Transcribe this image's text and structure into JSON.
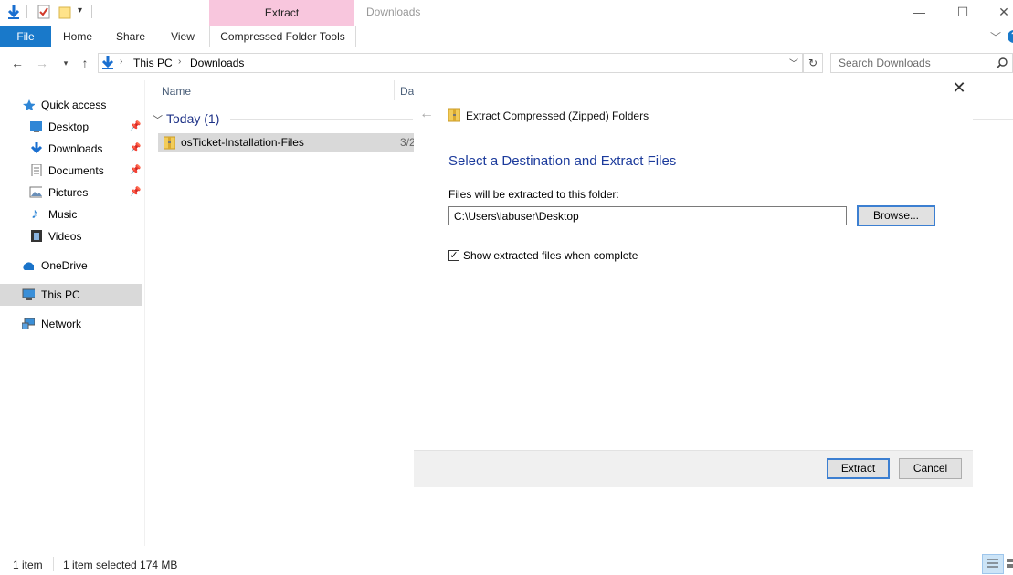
{
  "window": {
    "context_tab_label": "Extract",
    "title": "Downloads",
    "minimize": "—",
    "maximize": "☐",
    "close": "✕"
  },
  "ribbon": {
    "tabs": [
      "File",
      "Home",
      "Share",
      "View",
      "Compressed Folder Tools"
    ],
    "help_glyph": "?"
  },
  "address": {
    "crumbs": [
      "This PC",
      "Downloads"
    ],
    "search_placeholder": "Search Downloads"
  },
  "nav": {
    "quick_access": "Quick access",
    "items": [
      {
        "label": "Desktop",
        "icon": "desktop-icon",
        "pinned": true
      },
      {
        "label": "Downloads",
        "icon": "download-folder-icon",
        "pinned": true
      },
      {
        "label": "Documents",
        "icon": "documents-icon",
        "pinned": true
      },
      {
        "label": "Pictures",
        "icon": "pictures-icon",
        "pinned": true
      },
      {
        "label": "Music",
        "icon": "music-icon",
        "pinned": false
      },
      {
        "label": "Videos",
        "icon": "videos-icon",
        "pinned": false
      }
    ],
    "onedrive": "OneDrive",
    "this_pc": "This PC",
    "network": "Network"
  },
  "content": {
    "columns": [
      "Name",
      "Da"
    ],
    "group": "Today (1)",
    "files": [
      {
        "name": "osTicket-Installation-Files",
        "date_fragment": "3/2"
      }
    ]
  },
  "dialog": {
    "title": "Extract Compressed (Zipped) Folders",
    "heading": "Select a Destination and Extract Files",
    "dest_label": "Files will be extracted to this folder:",
    "dest_value": "C:\\Users\\labuser\\Desktop",
    "browse": "Browse...",
    "show_files_label": "Show extracted files when complete",
    "show_files_checked": true,
    "extract": "Extract",
    "cancel": "Cancel"
  },
  "status": {
    "items": "1 item",
    "selected": "1 item selected  174 MB"
  },
  "colors": {
    "accent": "#1979ca",
    "context_tab": "#f8c6dd",
    "heading_blue": "#1c3b9c"
  }
}
